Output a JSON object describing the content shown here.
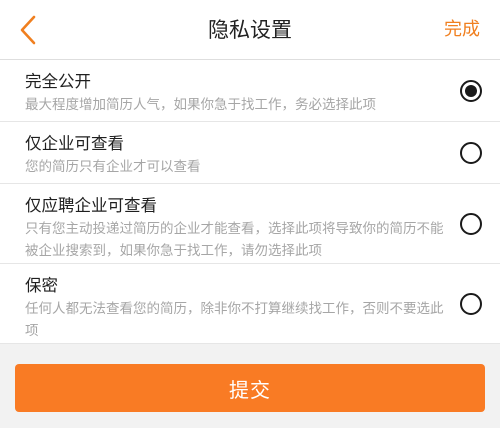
{
  "header": {
    "title": "隐私设置",
    "done_label": "完成",
    "back_icon": "chevron-left-icon"
  },
  "options": [
    {
      "title": "完全公开",
      "description": "最大程度增加简历人气，如果你急于找工作，务必选择此项",
      "selected": true
    },
    {
      "title": "仅企业可查看",
      "description": "您的简历只有企业才可以查看",
      "selected": false
    },
    {
      "title": "仅应聘企业可查看",
      "description": "只有您主动投递过简历的企业才能查看，选择此项将导致你的简历不能被企业搜索到，如果你急于找工作，请勿选择此项",
      "selected": false
    },
    {
      "title": "保密",
      "description": "任何人都无法查看您的简历，除非你不打算继续找工作，否则不要选此项",
      "selected": false
    }
  ],
  "submit_label": "提交",
  "colors": {
    "accent": "#f07f1f",
    "button": "#f97b24",
    "background": "#f2f2f2"
  }
}
